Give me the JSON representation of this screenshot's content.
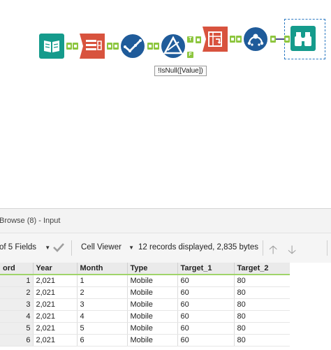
{
  "canvas": {
    "annotation_text": "!IsNull([Value])",
    "filter_true_label": "T",
    "filter_false_label": "F",
    "tools": [
      {
        "name": "input-data-tool-icon",
        "color": "#159b8c"
      },
      {
        "name": "text-to-columns-tool-icon",
        "color": "#d8533e"
      },
      {
        "name": "data-cleansing-tool-icon",
        "color": "#1f5b9a"
      },
      {
        "name": "filter-tool-icon",
        "color": "#1f5b9a"
      },
      {
        "name": "transpose-tool-icon",
        "color": "#d8533e"
      },
      {
        "name": "cross-tab-tool-icon",
        "color": "#1f5b9a"
      },
      {
        "name": "browse-tool-icon",
        "color": "#159b8c"
      }
    ]
  },
  "panel": {
    "title": "Browse (8) - Input"
  },
  "toolbar": {
    "fields_label": "of 5 Fields",
    "cell_viewer_label": "Cell Viewer",
    "records_info": "12 records displayed, 2,835 bytes"
  },
  "grid": {
    "columns": [
      "ord",
      "Year",
      "Month",
      "Type",
      "Target_1",
      "Target_2"
    ],
    "rows": [
      [
        "1",
        "2,021",
        "1",
        "Mobile",
        "60",
        "80"
      ],
      [
        "2",
        "2,021",
        "2",
        "Mobile",
        "60",
        "80"
      ],
      [
        "3",
        "2,021",
        "3",
        "Mobile",
        "60",
        "80"
      ],
      [
        "4",
        "2,021",
        "4",
        "Mobile",
        "60",
        "80"
      ],
      [
        "5",
        "2,021",
        "5",
        "Mobile",
        "60",
        "80"
      ],
      [
        "6",
        "2,021",
        "6",
        "Mobile",
        "60",
        "80"
      ]
    ]
  },
  "colors": {
    "anchor": "#8dc63f",
    "teal": "#159b8c",
    "orange": "#d8533e",
    "blue": "#1f5b9a",
    "selection": "#2b79c2"
  }
}
